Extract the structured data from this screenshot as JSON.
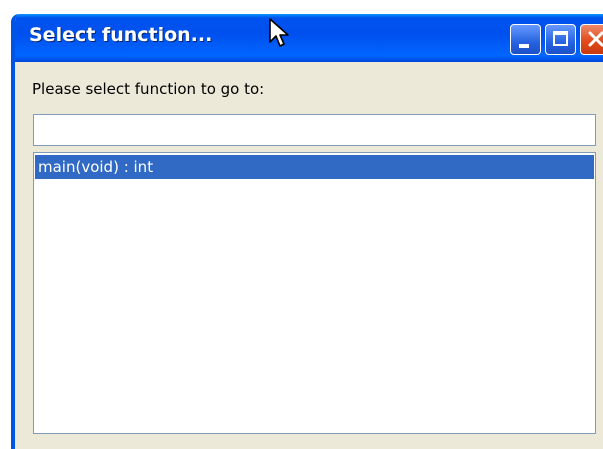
{
  "window": {
    "title": "Select function..."
  },
  "titlebar_buttons": {
    "minimize_icon": "minimize-icon",
    "maximize_icon": "maximize-icon",
    "close_icon": "close-icon"
  },
  "dialog": {
    "prompt": "Please select function to go to:",
    "search_value": "",
    "search_placeholder": ""
  },
  "functions": {
    "items": [
      {
        "label": "main(void) : int",
        "selected": true
      }
    ]
  },
  "colors": {
    "titlebar": "#0054e3",
    "selection": "#316ac5",
    "dialog_bg": "#ece9d8",
    "close_button": "#e24a1c"
  }
}
